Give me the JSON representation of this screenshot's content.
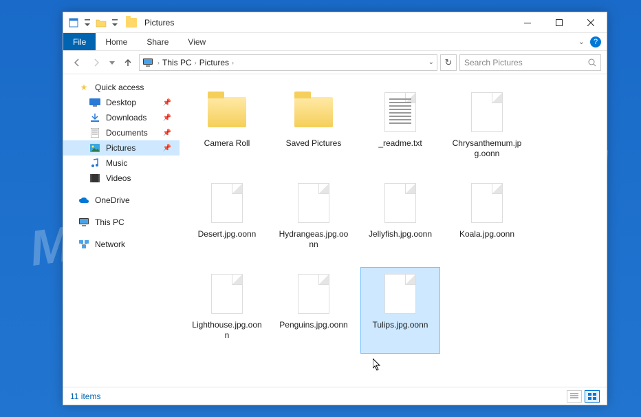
{
  "watermark": "MYANTISPYWARE.COM",
  "window": {
    "title": "Pictures"
  },
  "ribbon": {
    "file": "File",
    "home": "Home",
    "share": "Share",
    "view": "View"
  },
  "address": {
    "seg1": "This PC",
    "seg2": "Pictures"
  },
  "search": {
    "placeholder": "Search Pictures"
  },
  "nav": {
    "quick_access": "Quick access",
    "desktop": "Desktop",
    "downloads": "Downloads",
    "documents": "Documents",
    "pictures": "Pictures",
    "music": "Music",
    "videos": "Videos",
    "onedrive": "OneDrive",
    "this_pc": "This PC",
    "network": "Network"
  },
  "items": [
    {
      "name": "Camera Roll",
      "type": "folder"
    },
    {
      "name": "Saved Pictures",
      "type": "folder"
    },
    {
      "name": "_readme.txt",
      "type": "text"
    },
    {
      "name": "Chrysanthemum.jpg.oonn",
      "type": "blank"
    },
    {
      "name": "Desert.jpg.oonn",
      "type": "blank"
    },
    {
      "name": "Hydrangeas.jpg.oonn",
      "type": "blank"
    },
    {
      "name": "Jellyfish.jpg.oonn",
      "type": "blank"
    },
    {
      "name": "Koala.jpg.oonn",
      "type": "blank"
    },
    {
      "name": "Lighthouse.jpg.oonn",
      "type": "blank"
    },
    {
      "name": "Penguins.jpg.oonn",
      "type": "blank"
    },
    {
      "name": "Tulips.jpg.oonn",
      "type": "blank",
      "selected": true
    }
  ],
  "status": {
    "count": "11 items"
  }
}
